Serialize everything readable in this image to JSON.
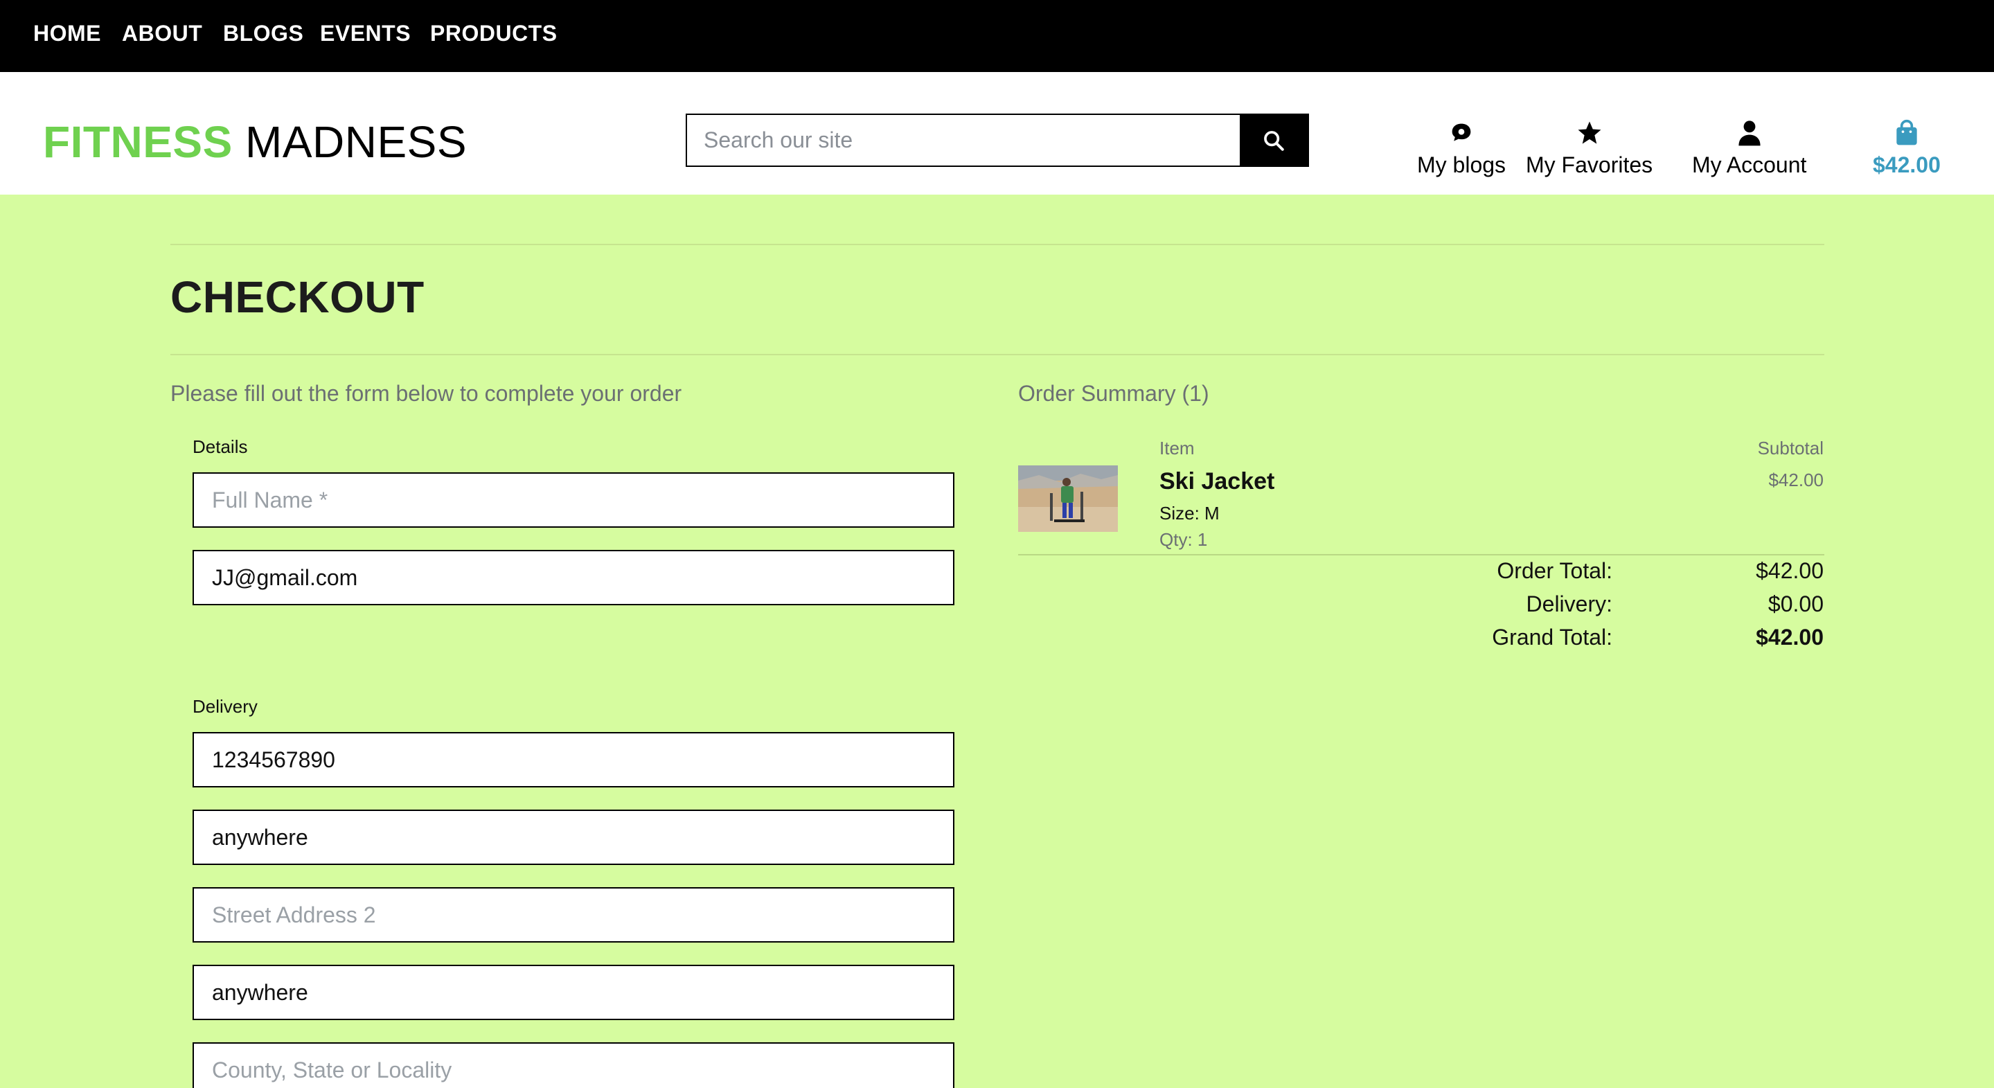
{
  "nav": {
    "items": [
      "HOME",
      "ABOUT",
      "BLOGS",
      "EVENTS",
      "PRODUCTS"
    ]
  },
  "header": {
    "logo_part1": "FITNESS",
    "logo_part2": "MADNESS",
    "search_placeholder": "Search our site",
    "my_blogs": "My blogs",
    "my_favorites": "My Favorites",
    "my_account": "My Account",
    "cart_total": "$42.00",
    "cart_color": "#3a9bbf"
  },
  "page": {
    "title": "CHECKOUT",
    "form_intro": "Please fill out the form below to complete your order",
    "order_summary_title": "Order Summary (1)"
  },
  "form": {
    "details_label": "Details",
    "full_name_placeholder": "Full Name *",
    "email_value": "JJ@gmail.com",
    "delivery_label": "Delivery",
    "phone_value": "1234567890",
    "street1_value": "anywhere",
    "street2_placeholder": "Street Address 2",
    "town_value": "anywhere",
    "county_placeholder": "County, State or Locality"
  },
  "summary": {
    "item_header": "Item",
    "subtotal_header": "Subtotal",
    "item": {
      "name": "Ski Jacket",
      "size": "Size: M",
      "qty": "Qty: 1",
      "subtotal": "$42.00"
    },
    "order_total_label": "Order Total:",
    "order_total_value": "$42.00",
    "delivery_label": "Delivery:",
    "delivery_value": "$0.00",
    "grand_total_label": "Grand Total:",
    "grand_total_value": "$42.00"
  },
  "colors": {
    "background": "#d6fc9f",
    "logo_green": "#6fd14f",
    "nav_bg": "#000000"
  }
}
